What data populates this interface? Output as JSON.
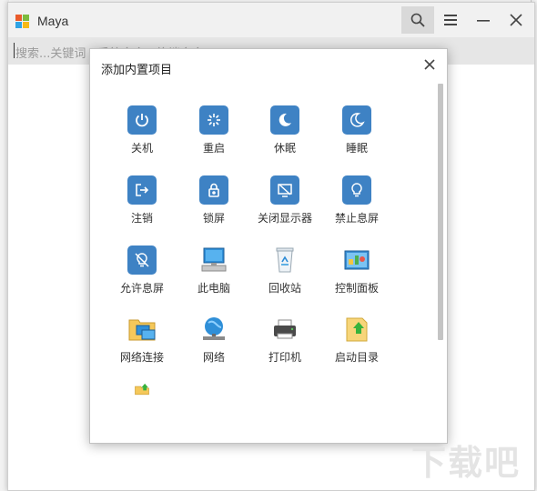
{
  "window": {
    "title": "Maya"
  },
  "search": {
    "placeholder": "搜索...关键词 / 系统命令 / 终端命令"
  },
  "dialog": {
    "title": "添加内置项目",
    "items": [
      {
        "label": "关机",
        "icon": "power-icon"
      },
      {
        "label": "重启",
        "icon": "restart-icon"
      },
      {
        "label": "休眠",
        "icon": "hibernate-moon-icon"
      },
      {
        "label": "睡眠",
        "icon": "sleep-moon-icon"
      },
      {
        "label": "注销",
        "icon": "logout-icon"
      },
      {
        "label": "锁屏",
        "icon": "lock-icon"
      },
      {
        "label": "关闭显示器",
        "icon": "monitor-off-icon"
      },
      {
        "label": "禁止息屏",
        "icon": "bulb-icon"
      },
      {
        "label": "允许息屏",
        "icon": "bulb-off-icon"
      },
      {
        "label": "此电脑",
        "icon": "computer-icon"
      },
      {
        "label": "回收站",
        "icon": "recycle-bin-icon"
      },
      {
        "label": "控制面板",
        "icon": "control-panel-icon"
      },
      {
        "label": "网络连接",
        "icon": "network-connections-icon"
      },
      {
        "label": "网络",
        "icon": "network-globe-icon"
      },
      {
        "label": "打印机",
        "icon": "printer-icon"
      },
      {
        "label": "启动目录",
        "icon": "startup-folder-icon"
      },
      {
        "label": "",
        "icon": "folder-up-icon"
      }
    ]
  },
  "colors": {
    "accent": "#3e82c4",
    "titlebar": "#f1f1f1",
    "searchbar": "#e6e6e6"
  }
}
